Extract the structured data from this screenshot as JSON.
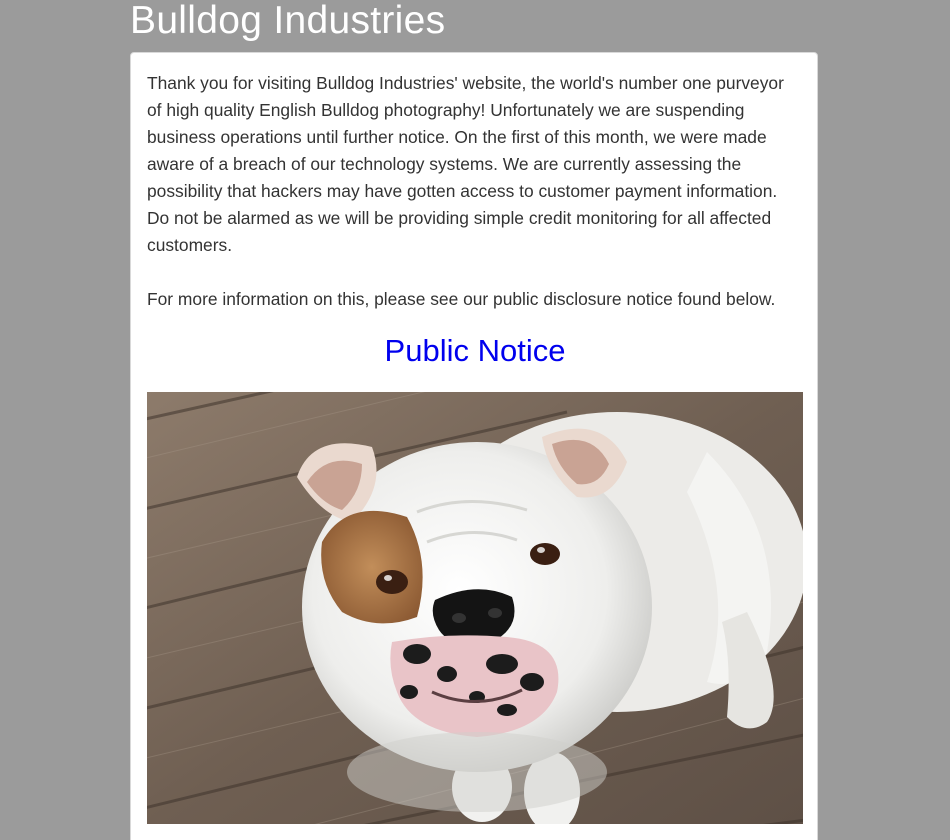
{
  "site": {
    "title": "Bulldog Industries"
  },
  "notice": {
    "intro_text": "Thank you for visiting Bulldog Industries' website, the world's number one purveyor of high quality English Bulldog photography! Unfortunately we are suspending business operations until further notice. On the first of this month, we were made aware of a breach of our technology systems. We are currently assessing the possibility that hackers may have gotten access to customer payment information. Do not be alarmed as we will be providing simple credit monitoring for all affected customers.",
    "more_info_text": "For more information on this, please see our public disclosure notice found below.",
    "link_label": "Public Notice"
  },
  "photo": {
    "icon": "bulldog-photo",
    "subject": "white and tan English bulldog on a wooden deck"
  },
  "colors": {
    "background": "#9b9b9b",
    "card": "#ffffff",
    "text": "#333333",
    "link": "#0000ee",
    "title": "#ffffff"
  }
}
